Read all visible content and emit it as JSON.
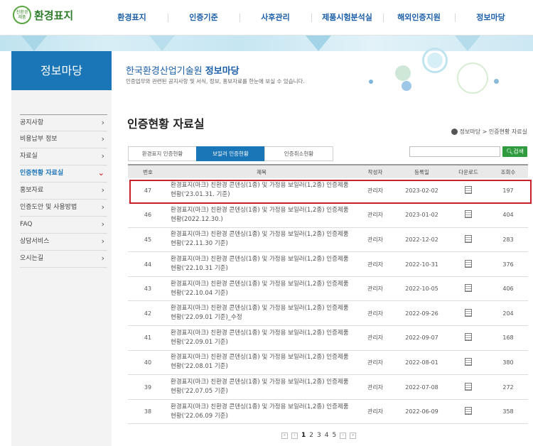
{
  "header": {
    "logo_mark": "친환경 제품",
    "logo_text": "환경표지",
    "nav": [
      "환경표지",
      "인증기준",
      "사후관리",
      "제품시험분석실",
      "해외인증지원",
      "정보마당"
    ]
  },
  "sidebar": {
    "title": "정보마당",
    "items": [
      {
        "label": "공지사항"
      },
      {
        "label": "비용납부 정보"
      },
      {
        "label": "자료실"
      },
      {
        "label": "인증현황 자료실",
        "active": true
      },
      {
        "label": "홍보자료"
      },
      {
        "label": "인증도안 및 사용방법"
      },
      {
        "label": "FAQ"
      },
      {
        "label": "상담서비스"
      },
      {
        "label": "오시는길"
      }
    ]
  },
  "intro": {
    "org": "한국환경산업기술원",
    "section": "정보마당",
    "description": "인증업무와 관련된 공지사항 및 서식, 정보, 홍보자료를 한눈에 보실 수 있습니다."
  },
  "page": {
    "title": "인증현황 자료실",
    "breadcrumb": "정보마당 > 인증현황 자료실"
  },
  "tabs": [
    {
      "label": "환경표지 인증현황",
      "active": false
    },
    {
      "label": "보일러 인증현황",
      "active": true
    },
    {
      "label": "인증취소현황",
      "active": false
    }
  ],
  "search": {
    "value": "",
    "button": "검색"
  },
  "table": {
    "headers": [
      "번호",
      "제목",
      "작성자",
      "등록일",
      "다운로드",
      "조회수"
    ],
    "rows": [
      {
        "no": "47",
        "title": "환경표지(마크) 친환경 콘덴싱(1종) 및 가정용 보일러(1,2종) 인증제품 현황('23.01.31. 기준)",
        "author": "관리자",
        "date": "2023-02-02",
        "views": "197"
      },
      {
        "no": "46",
        "title": "환경표지(마크) 친환경 콘덴싱(1종) 및 가정용 보일러(1,2종) 인증제품 현황(2022.12.30.)",
        "author": "관리자",
        "date": "2023-01-02",
        "views": "404"
      },
      {
        "no": "45",
        "title": "환경표지(마크) 친환경 콘덴싱(1종) 및 가정용 보일러(1,2종) 인증제품 현황('22.11.30 기준)",
        "author": "관리자",
        "date": "2022-12-02",
        "views": "283"
      },
      {
        "no": "44",
        "title": "환경표지(마크) 친환경 콘덴싱(1종) 및 가정용 보일러(1,2종) 인증제품 현황('22.10.31 기준)",
        "author": "관리자",
        "date": "2022-10-31",
        "views": "376"
      },
      {
        "no": "43",
        "title": "환경표지(마크) 친환경 콘덴싱(1종) 및 가정용 보일러(1,2종) 인증제품 현황('22.10.04 기준)",
        "author": "관리자",
        "date": "2022-10-05",
        "views": "406"
      },
      {
        "no": "42",
        "title": "환경표지(마크) 친환경 콘덴싱(1종) 및 가정용 보일러(1,2종) 인증제품 현황('22.09.01 기준)_수정",
        "author": "관리자",
        "date": "2022-09-26",
        "views": "204"
      },
      {
        "no": "41",
        "title": "환경표지(마크) 친환경 콘덴싱(1종) 및 가정용 보일러(1,2종) 인증제품 현황('22.09.01 기준)",
        "author": "관리자",
        "date": "2022-09-07",
        "views": "168"
      },
      {
        "no": "40",
        "title": "환경표지(마크) 친환경 콘덴싱(1종) 및 가정용 보일러(1,2종) 인증제품 현황('22.08.01 기준)",
        "author": "관리자",
        "date": "2022-08-01",
        "views": "380"
      },
      {
        "no": "39",
        "title": "환경표지(마크) 친환경 콘덴싱(1종) 및 가정용 보일러(1,2종) 인증제품 현황('22.07.05 기준)",
        "author": "관리자",
        "date": "2022-07-08",
        "views": "272"
      },
      {
        "no": "38",
        "title": "환경표지(마크) 친환경 콘덴싱(1종) 및 가정용 보일러(1,2종) 인증제품 현황('22.06.09 기준)",
        "author": "관리자",
        "date": "2022-06-09",
        "views": "358"
      }
    ]
  },
  "pagination": {
    "pages": [
      "1",
      "2",
      "3",
      "4",
      "5"
    ],
    "current": "1"
  },
  "colors": {
    "brand_blue": "#1b76b8",
    "search_green": "#2f9a3e",
    "highlight_red": "#c8212b"
  }
}
